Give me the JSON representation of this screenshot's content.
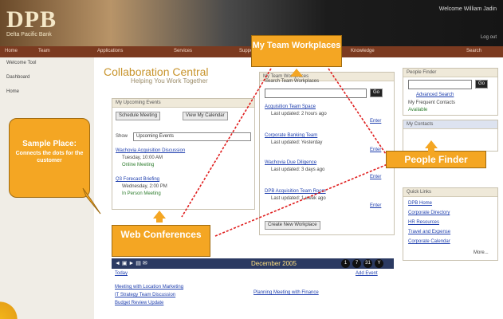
{
  "header": {
    "logo": "DPB",
    "logo_sub": "Delta Pacific Bank",
    "welcome": "Welcome William Jadin",
    "header_link": "Log out",
    "nav": [
      "Home",
      "Team",
      "Applications",
      "Services",
      "Support",
      "Knowledge",
      "Search"
    ]
  },
  "left_nav": {
    "items": [
      "Welcome Tool",
      "Dashboard",
      "Home"
    ]
  },
  "page": {
    "title": "Collaboration Central",
    "subtitle": "Helping You Work Together"
  },
  "events_portlet": {
    "header": "My Upcoming Events",
    "buttons": [
      "Schedule Meeting",
      "View My Calendar"
    ],
    "show_label": "Show",
    "filter_value": "Upcoming Events",
    "items": [
      {
        "title": "Wachovia Acquisition Discussion",
        "when": "Tuesday, 10:00 AM",
        "status": "Online Meeting"
      },
      {
        "title": "Q3 Forecast Briefing",
        "when": "Wednesday, 2:00 PM",
        "status": "In Person Meeting"
      }
    ]
  },
  "workplaces_portlet": {
    "header": "My Team Workplaces",
    "search_label": "Search Team Workplaces",
    "go": "Go",
    "items": [
      {
        "title": "Acquisition Team Space",
        "meta": "Last updated: 2 hours ago",
        "action": "Enter"
      },
      {
        "title": "Corporate Banking Team",
        "meta": "Last updated: Yesterday",
        "action": "Enter"
      },
      {
        "title": "Wachovia Due Diligence",
        "meta": "Last updated: 3 days ago",
        "action": "Enter"
      },
      {
        "title": "DPB Acquisition Team Room",
        "meta": "Last updated: 1 week ago",
        "action": "Enter"
      }
    ],
    "button": "Create New Workplace"
  },
  "right_column": {
    "people_header": "People Finder",
    "people_go": "Go",
    "people_link": "Advanced Search",
    "people_sub": "My Frequent Contacts",
    "people_status": "Available",
    "second_header": "My Contacts",
    "links_header": "Quick Links",
    "links": [
      "DPB Home",
      "Corporate Directory",
      "HR Resources",
      "Travel and Expense",
      "Corporate Calendar"
    ],
    "more": "More..."
  },
  "calendar": {
    "icons": "◄ ▣ ► ▤ ✉",
    "month": "December 2005",
    "nav": [
      "1",
      "7",
      "31",
      "Y"
    ],
    "today_link": "Today",
    "right_link": "Add Event",
    "entries": [
      "Meeting with Location Marketing",
      "IT Strategy Team Discussion",
      "Budget Review Update",
      "Planning Meeting with Finance"
    ]
  },
  "callouts": {
    "team_workplaces": "My Team Workplaces",
    "people_finder": "People Finder",
    "web_conferences": "Web Conferences",
    "sample_place_title": "Sample Place:",
    "sample_place_body": "Connects the dots for the customer"
  },
  "colors": {
    "accent": "#f4a623",
    "nav_bar": "#7b3a20",
    "link": "#1f3fae",
    "dotted_line": "#e01f1f"
  }
}
